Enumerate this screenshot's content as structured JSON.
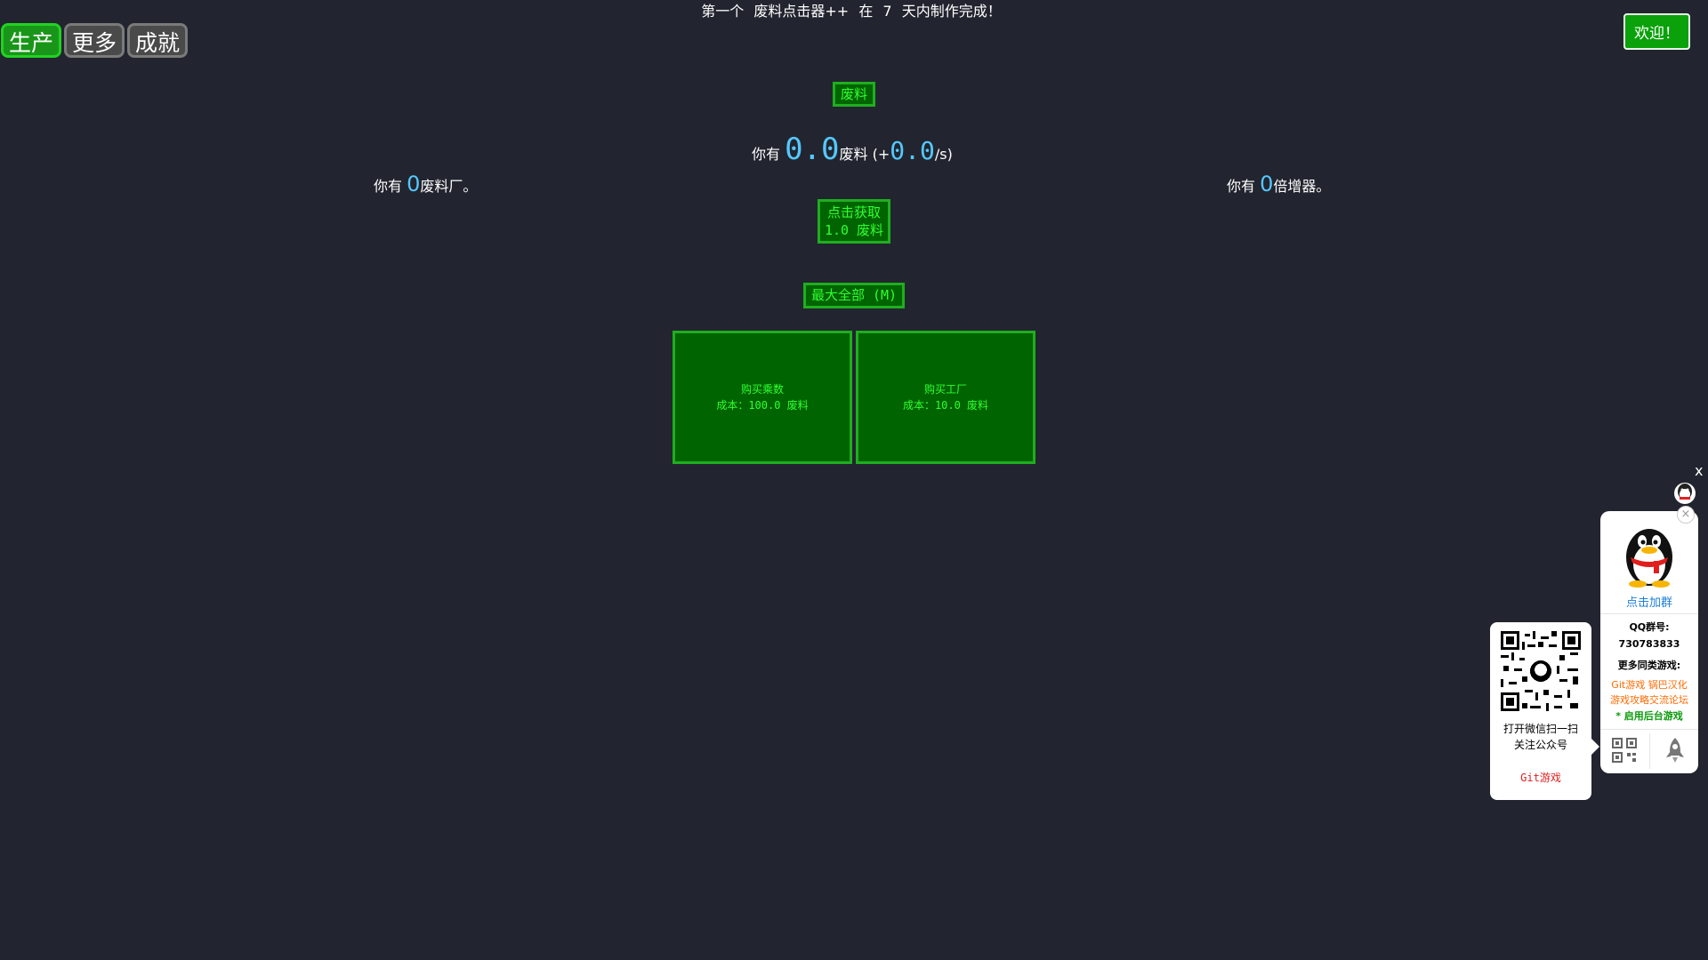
{
  "tabs": [
    {
      "label": "生产",
      "active": true
    },
    {
      "label": "更多",
      "active": false
    },
    {
      "label": "成就",
      "active": false
    }
  ],
  "news": [
    "第一个",
    "废料点击器++",
    "在",
    "7",
    "天内制作完成！"
  ],
  "welcome_label": "欢迎！",
  "resource_button": "废料",
  "scrap": {
    "prefix": "你有",
    "amount": "0.0",
    "unit": "废料",
    "rate_open": "(+",
    "rate": "0.0",
    "rate_close": "/s)"
  },
  "factories": {
    "prefix": "你有",
    "count": "0",
    "suffix": "废料厂。"
  },
  "multipliers": {
    "prefix": "你有",
    "count": "0",
    "suffix": "倍增器。"
  },
  "click_button": {
    "line1": "点击获取",
    "line2": "1.0 废料"
  },
  "max_all_button": "最大全部 (M)",
  "buy_multiplier": {
    "title": "购买乘数",
    "cost": "成本：100.0 废料"
  },
  "buy_factory": {
    "title": "购买工厂",
    "cost": "成本：10.0 废料"
  },
  "side": {
    "close_x": "x",
    "join_group": "点击加群",
    "qq_label": "QQ群号:",
    "qq_number": "730783833",
    "more_games": "更多同类游戏:",
    "link1": "Git游戏",
    "link2": "锅巴汉化",
    "link3": "游戏攻略交流论坛",
    "background_hint": "* 启用后台游戏",
    "qr_text_1": "打开微信扫一扫",
    "qr_text_2": "关注公众号",
    "qr_link": "Git游戏"
  },
  "colors": {
    "background": "#22252f",
    "accent_green": "#31ff31",
    "button_green": "#006400",
    "number_blue": "#55c8ff"
  }
}
